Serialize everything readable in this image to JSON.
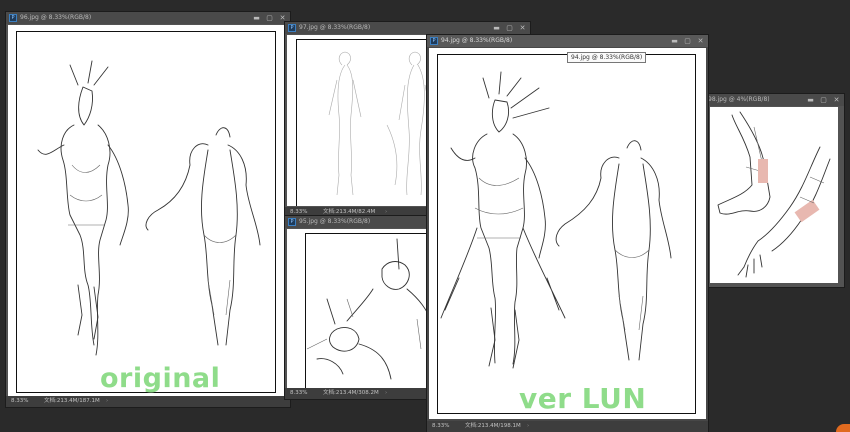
{
  "windows": [
    {
      "id": "w96",
      "title": "96.jpg @ 8.33%(RGB/8)",
      "zoom": "8.33%",
      "doc": "文档:213.4M/187.1M",
      "caption": "original"
    },
    {
      "id": "w97",
      "title": "97.jpg @ 8.33%(RGB/8)",
      "zoom": "8.33%",
      "doc": "文档:213.4M/82.4M"
    },
    {
      "id": "w95",
      "title": "95.jpg @ 8.33%(RGB/8)",
      "zoom": "8.33%",
      "doc": "文档:213.4M/308.2M"
    },
    {
      "id": "w94",
      "title": "94.jpg @ 8.33%(RGB/8)",
      "zoom": "8.33%",
      "doc": "文档:213.4M/198.1M",
      "caption": "ver LUN",
      "tooltip": "94.jpg @ 8.33%(RGB/8)"
    },
    {
      "id": "w98",
      "title": "98.jpg @ 4%(RGB/8)"
    }
  ],
  "window_buttons": {
    "minimize": "▬",
    "restore": "▢",
    "close": "✕"
  },
  "status_arrow": "›",
  "icons": {
    "app": "Ps",
    "accent": "#8fdc8a"
  }
}
